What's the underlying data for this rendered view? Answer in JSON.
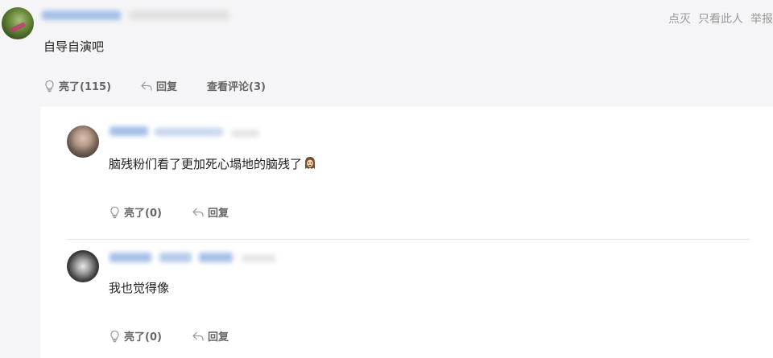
{
  "main_comment": {
    "text": "自导自演吧",
    "like_label": "亮了(115)",
    "reply_label": "回复",
    "view_comments_label": "查看评论(3)"
  },
  "top_actions": {
    "dislike": "点灭",
    "only_this_user": "只看此人",
    "report": "举报"
  },
  "replies": [
    {
      "text": "脑残粉们看了更加死心塌地的脑残了",
      "like_label": "亮了(0)",
      "reply_label": "回复"
    },
    {
      "text": "我也觉得像",
      "like_label": "亮了(0)",
      "reply_label": "回复"
    }
  ],
  "colors": {
    "page_bg": "#f5f5f7",
    "panel_bg": "#ffffff",
    "muted": "#999999",
    "action": "#666666"
  },
  "icons": {
    "like": "lightbulb-icon",
    "reply": "reply-arrow-icon",
    "emoji": "ghost-face-emoji-icon"
  }
}
